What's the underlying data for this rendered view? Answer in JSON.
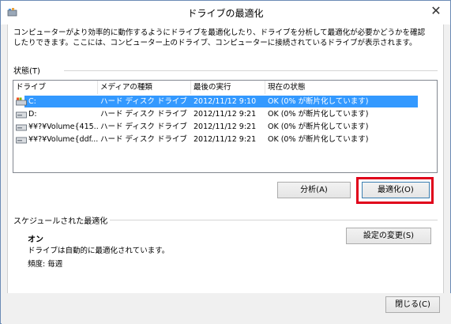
{
  "window": {
    "title": "ドライブの最適化",
    "close_glyph": "✕"
  },
  "description": "コンピューターがより効率的に動作するようにドライブを最適化したり、ドライブを分析して最適化が必要かどうかを確認したりできます。ここには、コンピューター上のドライブ、コンピューターに接続されているドライブが表示されます。",
  "status": {
    "label": "状態(T)"
  },
  "table": {
    "columns": [
      "ドライブ",
      "メディアの種類",
      "最後の実行",
      "現在の状態"
    ],
    "rows": [
      {
        "drive": "C:",
        "media": "ハード ディスク ドライブ",
        "last_run": "2012/11/12 9:10",
        "status": "OK (0% が断片化しています)",
        "selected": true,
        "icon": "system-drive-icon"
      },
      {
        "drive": "D:",
        "media": "ハード ディスク ドライブ",
        "last_run": "2012/11/12 9:21",
        "status": "OK (0% が断片化しています)",
        "selected": false,
        "icon": "hard-drive-icon"
      },
      {
        "drive": "¥¥?¥Volume{415...",
        "media": "ハード ディスク ドライブ",
        "last_run": "2012/11/12 9:21",
        "status": "OK (0% が断片化しています)",
        "selected": false,
        "icon": "hard-drive-icon"
      },
      {
        "drive": "¥¥?¥Volume{ddf...",
        "media": "ハード ディスク ドライブ",
        "last_run": "2012/11/12 9:21",
        "status": "OK (0% が断片化しています)",
        "selected": false,
        "icon": "hard-drive-icon"
      }
    ]
  },
  "buttons": {
    "analyze": "分析(A)",
    "optimize": "最適化(O)",
    "change_settings": "設定の変更(S)",
    "close": "閉じる(C)"
  },
  "schedule": {
    "label": "スケジュールされた最適化",
    "state": "オン",
    "description": "ドライブは自動的に最適化されています。",
    "frequency": "頻度: 毎週"
  },
  "colors": {
    "selection": "#3399ff",
    "highlight_box": "#e0001a"
  }
}
